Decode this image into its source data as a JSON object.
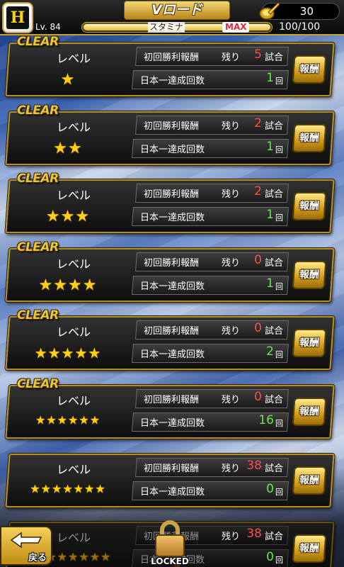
{
  "header": {
    "title": "Vロード",
    "coins": "30",
    "level_prefix": "Lv.",
    "level": "84",
    "stamina_label": "スタミナ",
    "stamina_max": "MAX",
    "stamina_value": "100/100",
    "stamina_fill_fraction": 1.0
  },
  "labels": {
    "clear": "CLEAR",
    "level": "レベル",
    "first_win_reward": "初回勝利報酬",
    "remaining": "残り",
    "games_unit": "試合",
    "japan_champion_count": "日本一達成回数",
    "times_unit": "回",
    "reward_button": "報酬",
    "locked": "LOCKED",
    "back": "戻る"
  },
  "levels": [
    {
      "stars": 1,
      "cleared": true,
      "remaining": "5",
      "wins": "1"
    },
    {
      "stars": 2,
      "cleared": true,
      "remaining": "2",
      "wins": "1"
    },
    {
      "stars": 3,
      "cleared": true,
      "remaining": "2",
      "wins": "1"
    },
    {
      "stars": 4,
      "cleared": true,
      "remaining": "0",
      "wins": "1"
    },
    {
      "stars": 5,
      "cleared": true,
      "remaining": "0",
      "wins": "2"
    },
    {
      "stars": 6,
      "cleared": true,
      "remaining": "0",
      "wins": "16"
    },
    {
      "stars": 7,
      "cleared": false,
      "remaining": "38",
      "wins": "0"
    },
    {
      "stars": 8,
      "cleared": false,
      "locked": true,
      "remaining": "38",
      "wins": "0"
    }
  ],
  "colors": {
    "gold": "#d8a11c",
    "remaining_red": "#ff4a4a",
    "wins_green": "#6ee05a",
    "star_yellow": "#ffd21a"
  }
}
